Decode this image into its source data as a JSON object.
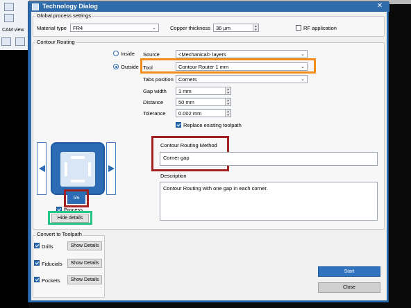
{
  "background": {
    "cam_view_label": "CAM view"
  },
  "dialog": {
    "title": "Technology Dialog",
    "close_glyph": "✕"
  },
  "global": {
    "legend": "Global process settings",
    "material_label": "Material type",
    "material_value": "FR4",
    "copper_label": "Copper thickness",
    "copper_value": "36 µm",
    "rf_label": "RF application",
    "rf_checked": false
  },
  "contour": {
    "legend": "Contour Routing",
    "inside_label": "Inside",
    "outside_label": "Outside",
    "selected_side": "Outside",
    "source_label": "Source",
    "source_value": "<Mechanical> layers",
    "tool_label": "Tool",
    "tool_value": "Contour Router 1 mm",
    "tabs_label": "Tabs position",
    "tabs_value": "Corners",
    "gap_label": "Gap width",
    "gap_value": "1 mm",
    "distance_label": "Distance",
    "distance_value": "50 mm",
    "tolerance_label": "Tolerance",
    "tolerance_value": "0.002 mm",
    "replace_label": "Replace existing toolpath",
    "replace_checked": true,
    "method_label": "Contour Routing Method",
    "method_value": "Corner gap",
    "description_label": "Description",
    "description_value": "Contour Routing with one gap in each corner.",
    "preview_page": "5/6",
    "process_label": "Process",
    "hide_details_label": "Hide details"
  },
  "convert": {
    "legend": "Convert to Toolpath",
    "items": [
      {
        "label": "Drills",
        "button": "Show Details",
        "checked": true
      },
      {
        "label": "Fiducials",
        "button": "Show Details",
        "checked": true
      },
      {
        "label": "Pockets",
        "button": "Show Details",
        "checked": true
      }
    ]
  },
  "actions": {
    "start_label": "Start",
    "close_label": "Close"
  },
  "colors": {
    "title_bar": "#2f6cab",
    "accent_blue": "#2f73bf",
    "highlight_orange": "#f28c1a",
    "highlight_red": "#a22020",
    "highlight_green": "#27c488"
  }
}
